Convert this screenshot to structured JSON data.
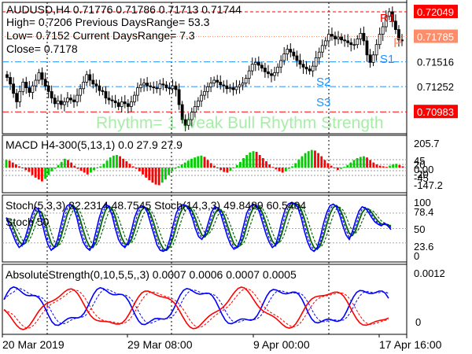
{
  "header": {
    "symbol_line": "AUDUSD,H4  0.71776 0.71786 0.71713 0.71744",
    "high_line": "High= 0.7206 Previous DaysRange= 53.3",
    "low_line": "Low= 0.7152 Current DaysRange= 7.3",
    "close_line": "Close= 0.7178"
  },
  "pivot_labels": {
    "r1": "R1",
    "p": "P",
    "s1": "S1",
    "s2": "S2",
    "s3": "S3"
  },
  "price_axis": {
    "labels": [
      "0.72049",
      "0.71785",
      "0.71516",
      "0.71252",
      "0.70983"
    ],
    "highlight_colors": [
      "#ff0000",
      "#ff8c69",
      "#ffffff",
      "#ffffff",
      "#ff0000"
    ]
  },
  "rhythm_text": "Rhythm= 1 Weak Bull Rhythm Strength",
  "macd": {
    "title": "MACD H4-300(5,13,1) 0.0 27.9 27.9",
    "labels": [
      "205.7",
      "45",
      "20",
      "0.00",
      "-20",
      "-45",
      "-147.2"
    ]
  },
  "stoch": {
    "title1": "Stoch(5,3,3) 32.2314 48.7545  Stoch(14,3,3) 49.8489 60.5404",
    "title2": "Stoch 50",
    "labels": [
      "100",
      "78.4",
      "50",
      "23.6",
      "0"
    ]
  },
  "abs": {
    "title": "AbsoluteStrength(0,10,5,5,,3) 0.0007 0.0006 0.0007 0.0005",
    "labels": [
      "0.0012",
      "0"
    ]
  },
  "time_axis": {
    "labels": [
      "20 Mar 2019",
      "29 Mar 08:00",
      "9 Apr 00:00",
      "17 Apr 16:00"
    ]
  },
  "colors": {
    "bull": "#00cc00",
    "bear": "#ff0000",
    "stoch_fast": "#0000ff",
    "stoch_slow": "#006400",
    "pivot_blue": "#1e90ff",
    "pivot_red": "#ff0000"
  },
  "chart_data": {
    "type": "line",
    "title": "AUDUSD,H4",
    "ylim": [
      0.7075,
      0.7215
    ],
    "pivots": {
      "R1": 0.72049,
      "P": 0.71785,
      "S1": 0.71516,
      "S2": 0.71252,
      "S3": 0.70983
    },
    "close_path": [
      0.7135,
      0.7128,
      0.7118,
      0.7109,
      0.712,
      0.713,
      0.7124,
      0.7119,
      0.7126,
      0.7132,
      0.714,
      0.7133,
      0.7126,
      0.712,
      0.7113,
      0.7107,
      0.711,
      0.7106,
      0.7109,
      0.7113,
      0.7111,
      0.7109,
      0.7116,
      0.7123,
      0.713,
      0.7138,
      0.7132,
      0.7128,
      0.7126,
      0.7121,
      0.712,
      0.7113,
      0.7111,
      0.711,
      0.7108,
      0.7104,
      0.7109,
      0.7107,
      0.7104,
      0.7109,
      0.7116,
      0.7124,
      0.7127,
      0.7129,
      0.7126,
      0.7125,
      0.7124,
      0.7123,
      0.7128,
      0.7127,
      0.7124,
      0.7123,
      0.7126,
      0.7122,
      0.7106,
      0.709,
      0.7084,
      0.709,
      0.7098,
      0.7104,
      0.711,
      0.7116,
      0.712,
      0.7125,
      0.7129,
      0.7132,
      0.713,
      0.7127,
      0.7126,
      0.7123,
      0.7124,
      0.7122,
      0.7125,
      0.7127,
      0.7129,
      0.7134,
      0.7142,
      0.7149,
      0.7151,
      0.7148,
      0.7145,
      0.7141,
      0.7139,
      0.7137,
      0.714,
      0.7146,
      0.7153,
      0.716,
      0.7165,
      0.7162,
      0.7158,
      0.7153,
      0.7149,
      0.7146,
      0.7144,
      0.7142,
      0.7147,
      0.7156,
      0.7162,
      0.7169,
      0.7174,
      0.7181,
      0.7179,
      0.7176,
      0.7178,
      0.7175,
      0.7174,
      0.7172,
      0.717,
      0.717,
      0.7176,
      0.7182,
      0.7174,
      0.7159,
      0.7151,
      0.7159,
      0.717,
      0.7181,
      0.7189,
      0.72,
      0.7205,
      0.7195,
      0.7186,
      0.7175,
      0.7174
    ],
    "macd_hist": [
      60,
      55,
      40,
      25,
      10,
      -5,
      -20,
      -35,
      -60,
      -80,
      -95,
      -110,
      -90,
      -60,
      -30,
      -10,
      20,
      45,
      70,
      60,
      40,
      15,
      -10,
      -25,
      -40,
      -55,
      -40,
      -20,
      -5,
      10,
      30,
      55,
      80,
      95,
      100,
      90,
      70,
      50,
      30,
      10,
      -10,
      -30,
      -55,
      -80,
      -100,
      -120,
      -135,
      -140,
      -120,
      -95,
      -60,
      -30,
      -10,
      10,
      25,
      40,
      55,
      70,
      80,
      90,
      95,
      85,
      60,
      35,
      15,
      -5,
      -20,
      -35,
      -40,
      -25,
      -5,
      20,
      45,
      75,
      100,
      120,
      130,
      125,
      100,
      75,
      50,
      25,
      5,
      -15,
      -30,
      -40,
      -30,
      -10,
      10,
      35,
      65,
      90,
      115,
      130,
      140,
      135,
      115,
      90,
      60,
      35,
      15,
      -5,
      -20,
      -10,
      5,
      20,
      40,
      60,
      75,
      85,
      90,
      80,
      60,
      40,
      25,
      15,
      10,
      5,
      15,
      25,
      30,
      20,
      10
    ],
    "stoch_fast": [
      70,
      55,
      40,
      25,
      15,
      20,
      35,
      55,
      75,
      90,
      85,
      65,
      40,
      20,
      10,
      15,
      30,
      55,
      80,
      92,
      95,
      88,
      70,
      45,
      25,
      15,
      10,
      20,
      45,
      70,
      88,
      95,
      90,
      75,
      50,
      30,
      20,
      15,
      25,
      45,
      70,
      85,
      92,
      90,
      80,
      60,
      40,
      20,
      10,
      8,
      12,
      30,
      55,
      78,
      90,
      94,
      92,
      85,
      70,
      50,
      35,
      30,
      40,
      60,
      80,
      90,
      88,
      75,
      55,
      35,
      20,
      12,
      15,
      30,
      55,
      78,
      90,
      95,
      92,
      80,
      60,
      40,
      25,
      15,
      20,
      40,
      65,
      85,
      95,
      98,
      96,
      88,
      70,
      45,
      25,
      12,
      8,
      15,
      35,
      60,
      80,
      92,
      95,
      90,
      75,
      55,
      38,
      30,
      45,
      65,
      82,
      90,
      88,
      80,
      70,
      62,
      58,
      55,
      60,
      55,
      48
    ]
  }
}
